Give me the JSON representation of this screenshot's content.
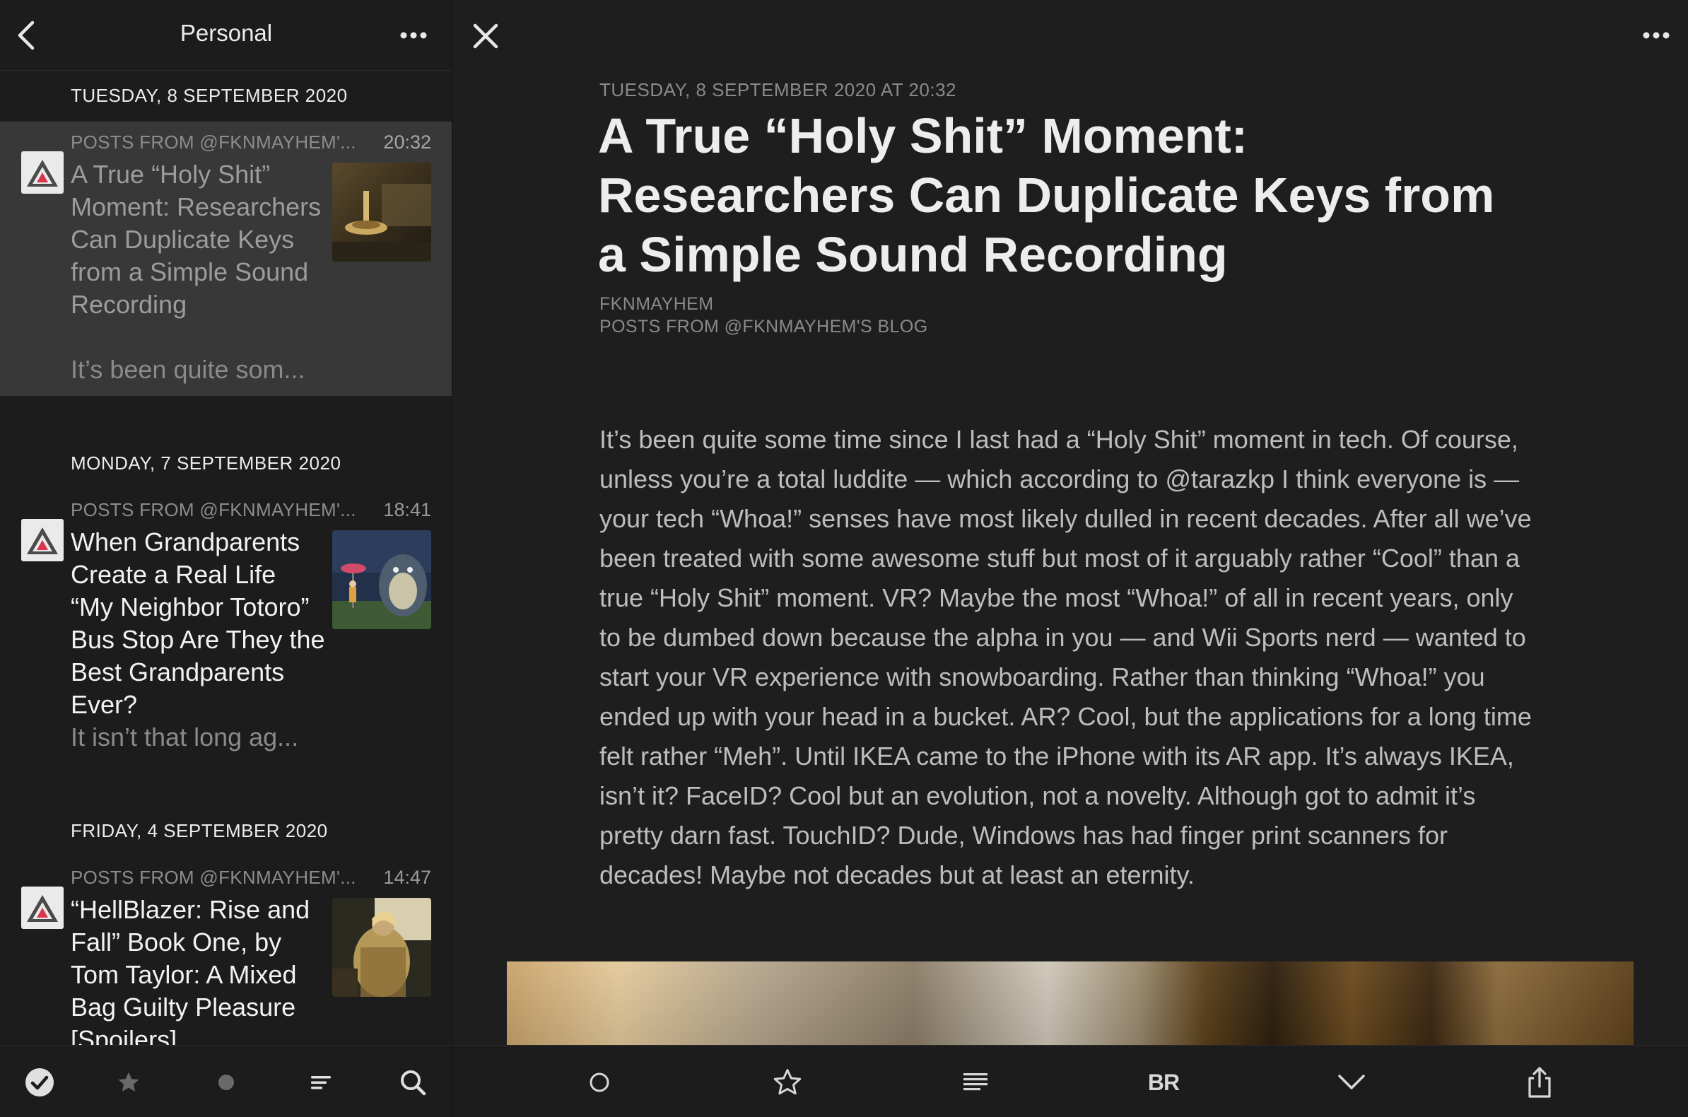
{
  "sidebar": {
    "title": "Personal",
    "groups": [
      {
        "date": "TUESDAY, 8 SEPTEMBER 2020",
        "items": [
          {
            "feed": "POSTS FROM @FKNMAYHEM'...",
            "time": "20:32",
            "title": "A True “Holy Shit” Moment: Researchers Can Duplicate Keys from a Simple Sound Recording",
            "snippet": "It’s been quite som...",
            "thumb": "spinning-top-thumbnail"
          }
        ]
      },
      {
        "date": "MONDAY, 7 SEPTEMBER 2020",
        "items": [
          {
            "feed": "POSTS FROM @FKNMAYHEM'...",
            "time": "18:41",
            "title": "When Grandparents Create a Real Life “My Neighbor Totoro” Bus Stop Are They the Best Grandparents Ever?",
            "snippet": "It isn’t that long ag...",
            "thumb": "totoro-thumbnail"
          }
        ]
      },
      {
        "date": "FRIDAY, 4 SEPTEMBER 2020",
        "items": [
          {
            "feed": "POSTS FROM @FKNMAYHEM'...",
            "time": "14:47",
            "title": "“HellBlazer: Rise and Fall” Book One, by Tom Taylor: A Mixed Bag Guilty Pleasure [Spoilers]",
            "snippet": "",
            "thumb": "hellblazer-thumbnail"
          }
        ]
      }
    ],
    "toolbar": [
      "mark-all-read-icon",
      "star-icon",
      "unread-dot-icon",
      "list-icon",
      "search-icon"
    ]
  },
  "article": {
    "date": "TUESDAY, 8 SEPTEMBER 2020 AT 20:32",
    "title": "A True “Holy Shit” Moment: Researchers Can Duplicate Keys from a Simple Sound Recording",
    "author": "FKNMAYHEM",
    "feed": "POSTS FROM @FKNMAYHEM'S BLOG",
    "body": "It’s been quite some time since I last had a “Holy Shit” moment in tech. Of course, unless you’re a total luddite — which according to @tarazkp I think everyone is — your tech “Whoa!” senses have most likely dulled in recent decades. After all we’ve been treated with some awesome stuff but most of it arguably rather “Cool” than a true “Holy Shit” moment. VR? Maybe the most “Whoa!” of all in recent years, only to be dumbed down because the alpha in you — and Wii Sports nerd — wanted to start your VR experience with snowboarding. Rather than thinking “Whoa!” you ended up with your head in a bucket. AR? Cool, but the applications for a long time felt rather “Meh”. Until IKEA came to the iPhone with its AR app. It’s always IKEA, isn’t it? FaceID? Cool but an evolution, not a novelty. Although got to admit it’s pretty darn fast. TouchID? Dude, Windows has had finger print scanners for decades! Maybe not decades but at least an eternity.",
    "reader_label": "BR"
  },
  "colors": {
    "background": "#1e1e1e",
    "selected_row": "#383838",
    "text_primary": "#ededed",
    "text_secondary": "#8a8a8a"
  }
}
